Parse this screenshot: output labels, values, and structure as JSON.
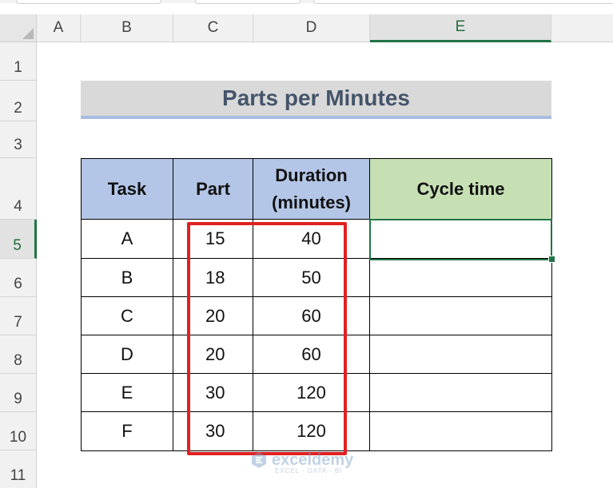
{
  "columns": [
    "A",
    "B",
    "C",
    "D",
    "E"
  ],
  "selected_column": "E",
  "rows": [
    "1",
    "2",
    "3",
    "4",
    "5",
    "6",
    "7",
    "8",
    "9",
    "10",
    "11"
  ],
  "selected_row": "5",
  "title": "Parts per Minutes",
  "table": {
    "headers": {
      "task": "Task",
      "part": "Part",
      "duration_line1": "Duration",
      "duration_line2": "(minutes)",
      "cycle": "Cycle time"
    },
    "data": [
      {
        "task": "A",
        "part": "15",
        "duration": "40",
        "cycle": ""
      },
      {
        "task": "B",
        "part": "18",
        "duration": "50",
        "cycle": ""
      },
      {
        "task": "C",
        "part": "20",
        "duration": "60",
        "cycle": ""
      },
      {
        "task": "D",
        "part": "20",
        "duration": "60",
        "cycle": ""
      },
      {
        "task": "E",
        "part": "30",
        "duration": "120",
        "cycle": ""
      },
      {
        "task": "F",
        "part": "30",
        "duration": "120",
        "cycle": ""
      }
    ]
  },
  "watermark": {
    "brand": "exceldemy",
    "tagline": "EXCEL · DATA · BI"
  },
  "colors": {
    "accent_green": "#217346",
    "header_blue": "#b4c6e7",
    "header_green": "#c6e0b4",
    "highlight_red": "#e02020"
  }
}
